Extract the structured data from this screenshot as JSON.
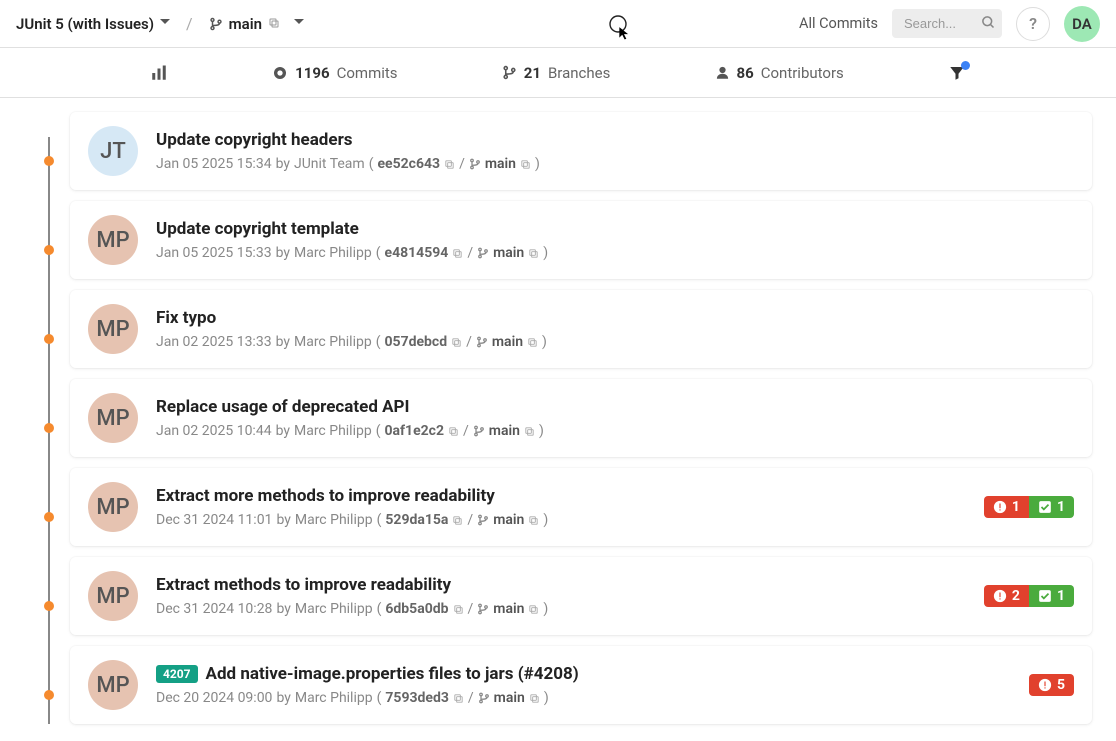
{
  "header": {
    "project_name": "JUnit 5 (with Issues)",
    "branch": "main",
    "all_commits_label": "All Commits",
    "search_placeholder": "Search...",
    "help_label": "?",
    "user_initials": "DA"
  },
  "subnav": {
    "commits_count": "1196",
    "commits_label": "Commits",
    "branches_count": "21",
    "branches_label": "Branches",
    "contributors_count": "86",
    "contributors_label": "Contributors"
  },
  "commits": [
    {
      "avatar_initials": "JT",
      "avatar_class": "av-blue",
      "title": "Update copyright headers",
      "date": "Jan 05 2025 15:34",
      "by": "by",
      "author": "JUnit Team",
      "hash": "ee52c643",
      "branch": "main",
      "pr_tag": "",
      "badge_red": "",
      "badge_green": ""
    },
    {
      "avatar_initials": "MP",
      "avatar_class": "av-pink",
      "title": "Update copyright template",
      "date": "Jan 05 2025 15:33",
      "by": "by",
      "author": "Marc Philipp",
      "hash": "e4814594",
      "branch": "main",
      "pr_tag": "",
      "badge_red": "",
      "badge_green": ""
    },
    {
      "avatar_initials": "MP",
      "avatar_class": "av-pink",
      "title": "Fix typo",
      "date": "Jan 02 2025 13:33",
      "by": "by",
      "author": "Marc Philipp",
      "hash": "057debcd",
      "branch": "main",
      "pr_tag": "",
      "badge_red": "",
      "badge_green": ""
    },
    {
      "avatar_initials": "MP",
      "avatar_class": "av-pink",
      "title": "Replace usage of deprecated API",
      "date": "Jan 02 2025 10:44",
      "by": "by",
      "author": "Marc Philipp",
      "hash": "0af1e2c2",
      "branch": "main",
      "pr_tag": "",
      "badge_red": "",
      "badge_green": ""
    },
    {
      "avatar_initials": "MP",
      "avatar_class": "av-pink",
      "title": "Extract more methods to improve readability",
      "date": "Dec 31 2024 11:01",
      "by": "by",
      "author": "Marc Philipp",
      "hash": "529da15a",
      "branch": "main",
      "pr_tag": "",
      "badge_red": "1",
      "badge_green": "1"
    },
    {
      "avatar_initials": "MP",
      "avatar_class": "av-pink",
      "title": "Extract methods to improve readability",
      "date": "Dec 31 2024 10:28",
      "by": "by",
      "author": "Marc Philipp",
      "hash": "6db5a0db",
      "branch": "main",
      "pr_tag": "",
      "badge_red": "2",
      "badge_green": "1"
    },
    {
      "avatar_initials": "MP",
      "avatar_class": "av-pink",
      "title": "Add native-image.properties files to jars (#4208)",
      "date": "Dec 20 2024 09:00",
      "by": "by",
      "author": "Marc Philipp",
      "hash": "7593ded3",
      "branch": "main",
      "pr_tag": "4207",
      "badge_red": "5",
      "badge_green": ""
    }
  ]
}
